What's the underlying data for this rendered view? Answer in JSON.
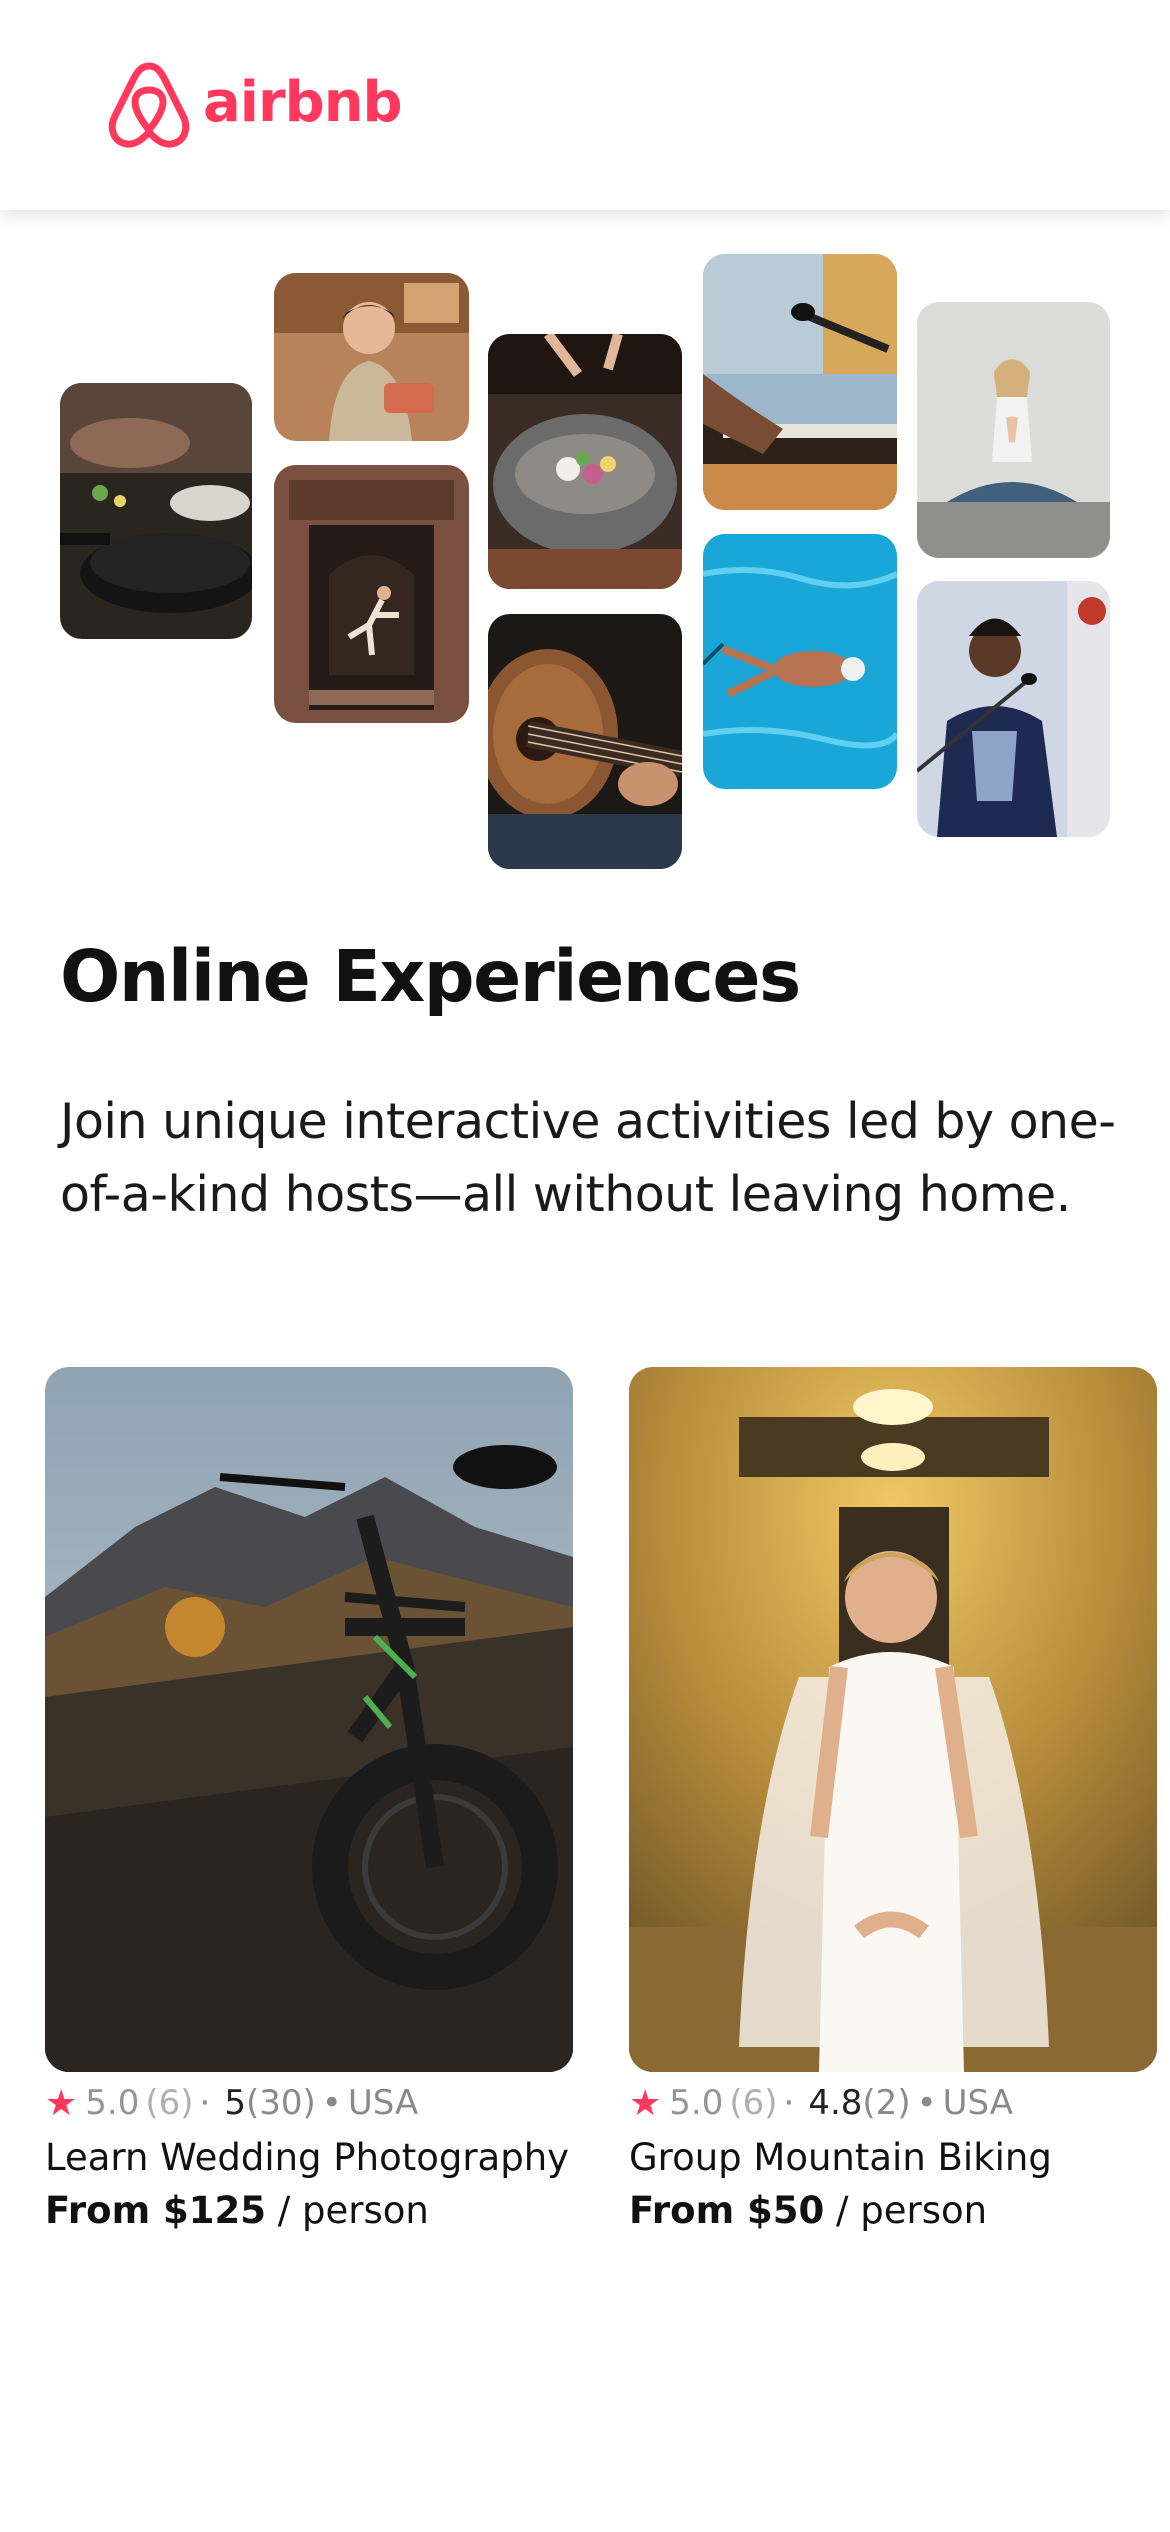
{
  "header": {
    "brand": "airbnb",
    "brand_color": "#ff385c"
  },
  "hero": {
    "title": "Online Experiences",
    "subtitle": "Join unique interactive activities led by one-of-a-kind hosts—all without leaving home."
  },
  "collage": [
    {
      "name": "cooking-pan-photo"
    },
    {
      "name": "chef-woman-photo"
    },
    {
      "name": "doorway-dancer-photo"
    },
    {
      "name": "plated-bowl-photo"
    },
    {
      "name": "acoustic-guitar-photo"
    },
    {
      "name": "microphone-keyboard-photo"
    },
    {
      "name": "swimmer-pool-photo"
    },
    {
      "name": "yoga-meditation-photo"
    },
    {
      "name": "singer-microphone-photo"
    }
  ],
  "cards": [
    {
      "ghost_rating": "5.0",
      "ghost_count": "(6)",
      "rating": "5",
      "count": "(30)",
      "location": "USA",
      "title": "Learn Wedding Photography",
      "price_strong": "From $125",
      "price_unit": " / person",
      "photo": "mountain-bike-photo"
    },
    {
      "ghost_rating": "5.0",
      "ghost_count": "(6)",
      "rating": "4.8",
      "count": "(2)",
      "location": "USA",
      "title": "Group Mountain Biking",
      "price_strong": "From $50",
      "price_unit": " / person",
      "photo": "bride-portrait-photo"
    }
  ],
  "icons": {
    "logo": "airbnb-logo-icon",
    "star": "star-icon"
  },
  "colors": {
    "accent": "#ff385c",
    "text": "#222222",
    "muted": "#8a8a8a"
  }
}
